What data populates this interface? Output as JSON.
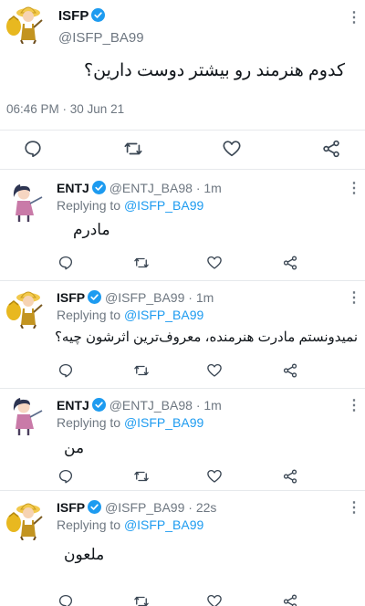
{
  "main_tweet": {
    "display_name": "ISFP",
    "handle": "@ISFP_BA99",
    "text": "کدوم هنرمند رو بیشتر دوست دارین؟",
    "timestamp": "06:46 PM · 30 Jun 21",
    "icons": [
      "comment-icon",
      "retweet-icon",
      "heart-icon",
      "share-icon"
    ]
  },
  "replies": [
    {
      "display_name": "ENTJ",
      "handle": "@ENTJ_BA98",
      "time": "· 1m",
      "replying_prefix": "Replying to",
      "replying_to": "@ISFP_BA99",
      "text": "مادرم"
    },
    {
      "display_name": "ISFP",
      "handle": "@ISFP_BA99",
      "time": "· 1m",
      "replying_prefix": "Replying to",
      "replying_to": "@ISFP_BA99",
      "text": "نمیدونستم مادرت هنرمنده، معروف‌ترین اثرشون چیه؟"
    },
    {
      "display_name": "ENTJ",
      "handle": "@ENTJ_BA98",
      "time": "· 1m",
      "replying_prefix": "Replying to",
      "replying_to": "@ISFP_BA99",
      "text": "من"
    },
    {
      "display_name": "ISFP",
      "handle": "@ISFP_BA99",
      "time": "· 22s",
      "replying_prefix": "Replying to",
      "replying_to": "@ISFP_BA99",
      "text": "ملعون"
    }
  ],
  "colors": {
    "verified": "#1d9bf0",
    "mention": "#1d9bf0",
    "secondary_text": "#6e7781",
    "divider": "#e6e9ec"
  }
}
